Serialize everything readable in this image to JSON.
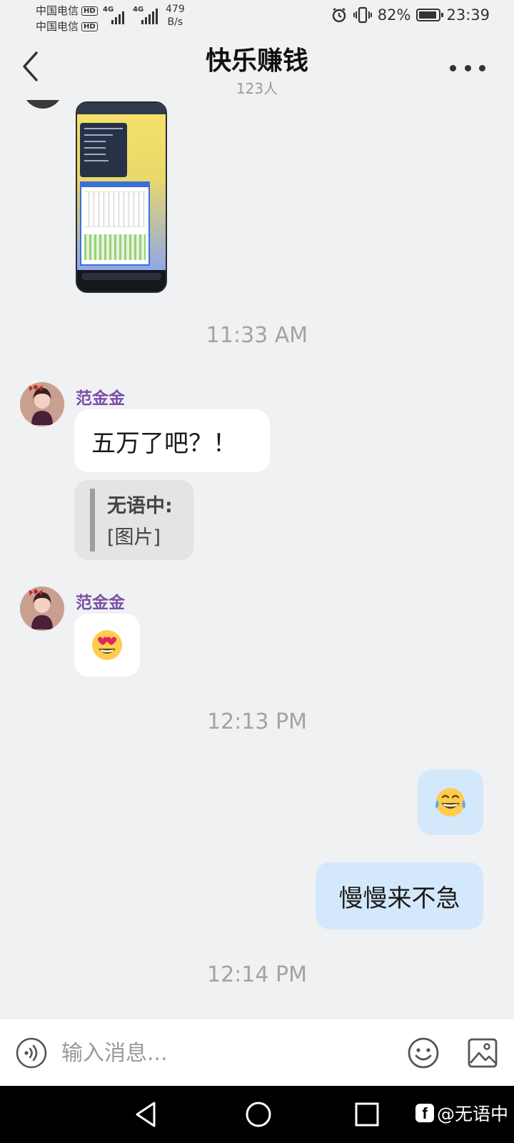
{
  "status_bar": {
    "carrier_1": "中国电信",
    "carrier_2": "中国电信",
    "hd_badge": "HD",
    "network_1": "4G",
    "network_2": "4G",
    "net_speed_value": "479",
    "net_speed_unit": "B/s",
    "battery": "82%",
    "time": "23:39"
  },
  "header": {
    "title": "快乐赚钱",
    "member_count": "123人"
  },
  "messages": {
    "timestamp_1": "11:33 AM",
    "msg1_sender": "范金金",
    "msg1_text": "五万了吧？！",
    "quote_name": "无语中:",
    "quote_text": "[图片]",
    "msg2_sender": "范金金",
    "timestamp_2": "12:13 PM",
    "my_msg2_text": "慢慢来不急",
    "timestamp_3": "12:14 PM"
  },
  "input_bar": {
    "placeholder": "输入消息..."
  },
  "watermark": {
    "logo": "f",
    "text": "@无语中"
  },
  "colors": {
    "background": "#f0f1f3",
    "sender_name": "#7b4fa6",
    "my_bubble": "#d4e8fb",
    "incoming_bubble": "#ffffff"
  },
  "icons": [
    "back-arrow-icon",
    "more-dots-icon",
    "voice-icon",
    "emoji-icon",
    "image-icon",
    "nav-back-icon",
    "nav-home-icon",
    "nav-recent-icon",
    "alarm-icon",
    "vibrate-icon",
    "battery-icon"
  ]
}
